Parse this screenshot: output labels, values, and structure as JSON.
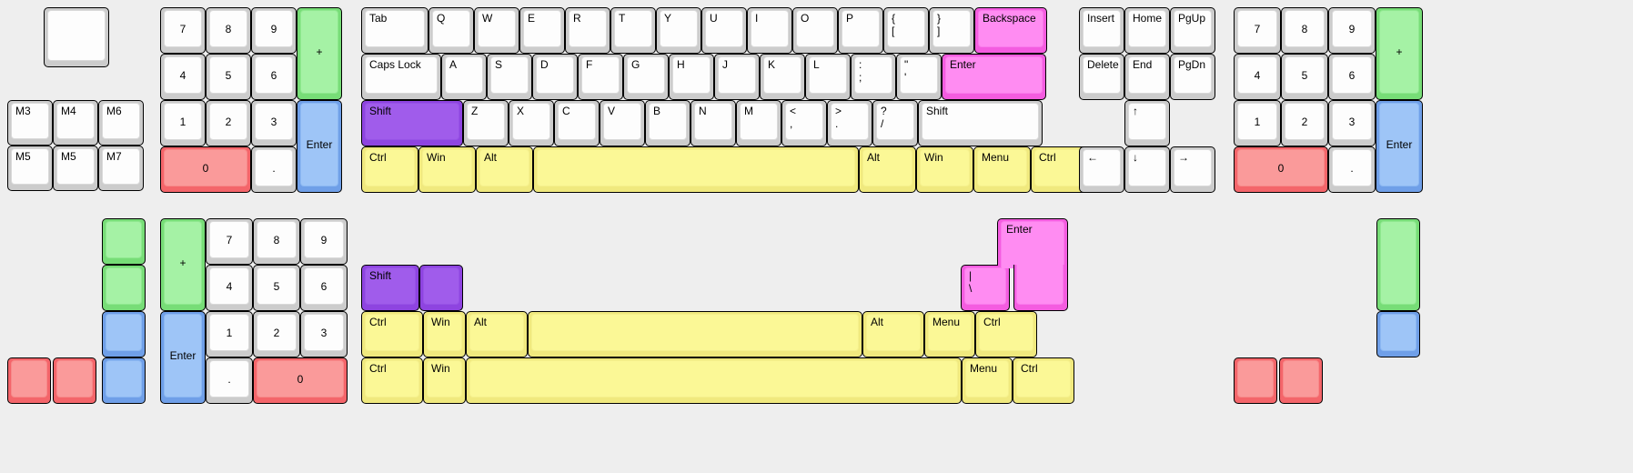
{
  "app": {
    "title": "Keyboard Layout Editor Canvas",
    "background_color": "#eeeeee"
  },
  "palette": {
    "white": "#cccccc",
    "white_cap": "#fdfdfd",
    "green": "#77dd77",
    "green_cap": "#a5f2a5",
    "blue": "#6f9fe8",
    "blue_cap": "#9ec5f7",
    "red": "#f4656a",
    "red_cap": "#fa9a9a",
    "yellow": "#f0e97e",
    "yellow_cap": "#fbf896",
    "purple": "#8e44e0",
    "purple_cap": "#a05ceb",
    "magenta": "#f45ce0",
    "magenta_cap": "#ff8cf2"
  },
  "upper_layout": {
    "standalone_key": {
      "label": ""
    },
    "macro_cluster": {
      "rows": [
        [
          {
            "label": "M3"
          },
          {
            "label": "M4"
          },
          {
            "label": "M6"
          }
        ],
        [
          {
            "label": "M5"
          },
          {
            "label": "M5"
          },
          {
            "label": "M7"
          }
        ]
      ]
    },
    "left_numpad": {
      "rows": [
        [
          {
            "label": "7"
          },
          {
            "label": "8"
          },
          {
            "label": "9"
          },
          {
            "label": "+"
          }
        ],
        [
          {
            "label": "4"
          },
          {
            "label": "5"
          },
          {
            "label": "6"
          }
        ],
        [
          {
            "label": "1"
          },
          {
            "label": "2"
          },
          {
            "label": "3"
          },
          {
            "label": "Enter"
          }
        ],
        [
          {
            "label": "0"
          },
          {
            "label": "."
          }
        ]
      ]
    },
    "main_block": {
      "row_tab": [
        {
          "label": "Tab"
        },
        {
          "label": "Q"
        },
        {
          "label": "W"
        },
        {
          "label": "E"
        },
        {
          "label": "R"
        },
        {
          "label": "T"
        },
        {
          "label": "Y"
        },
        {
          "label": "U"
        },
        {
          "label": "I"
        },
        {
          "label": "O"
        },
        {
          "label": "P"
        },
        {
          "label": "{\n["
        },
        {
          "label": "}\n]"
        },
        {
          "label": "Backspace"
        }
      ],
      "row_caps": [
        {
          "label": "Caps Lock"
        },
        {
          "label": "A"
        },
        {
          "label": "S"
        },
        {
          "label": "D"
        },
        {
          "label": "F"
        },
        {
          "label": "G"
        },
        {
          "label": "H"
        },
        {
          "label": "J"
        },
        {
          "label": "K"
        },
        {
          "label": "L"
        },
        {
          "label": ":\n;"
        },
        {
          "label": "\"\n'"
        },
        {
          "label": "Enter"
        }
      ],
      "row_shift": [
        {
          "label": "Shift"
        },
        {
          "label": "Z"
        },
        {
          "label": "X"
        },
        {
          "label": "C"
        },
        {
          "label": "V"
        },
        {
          "label": "B"
        },
        {
          "label": "N"
        },
        {
          "label": "M"
        },
        {
          "label": "<\n,"
        },
        {
          "label": ">\n."
        },
        {
          "label": "?\n/"
        },
        {
          "label": "Shift"
        }
      ],
      "row_bottom": [
        {
          "label": "Ctrl"
        },
        {
          "label": "Win"
        },
        {
          "label": "Alt"
        },
        {
          "label": ""
        },
        {
          "label": "Alt"
        },
        {
          "label": "Win"
        },
        {
          "label": "Menu"
        },
        {
          "label": "Ctrl"
        }
      ]
    },
    "nav_cluster": {
      "row1": [
        {
          "label": "Insert"
        },
        {
          "label": "Home"
        },
        {
          "label": "PgUp"
        }
      ],
      "row2": [
        {
          "label": "Delete"
        },
        {
          "label": "End"
        },
        {
          "label": "PgDn"
        }
      ],
      "arrow_up": {
        "label": "↑"
      },
      "arrow_row": [
        {
          "label": "←"
        },
        {
          "label": "↓"
        },
        {
          "label": "→"
        }
      ]
    },
    "right_numpad": {
      "rows": [
        [
          {
            "label": "7"
          },
          {
            "label": "8"
          },
          {
            "label": "9"
          },
          {
            "label": "+"
          }
        ],
        [
          {
            "label": "4"
          },
          {
            "label": "5"
          },
          {
            "label": "6"
          }
        ],
        [
          {
            "label": "1"
          },
          {
            "label": "2"
          },
          {
            "label": "3"
          },
          {
            "label": "Enter"
          }
        ],
        [
          {
            "label": "0"
          },
          {
            "label": "."
          }
        ]
      ]
    }
  },
  "lower_layout": {
    "left_color_column": [
      {
        "label": "",
        "color": "green"
      },
      {
        "label": "",
        "color": "green"
      },
      {
        "label": "",
        "color": "blue"
      },
      {
        "label": "",
        "color": "blue"
      }
    ],
    "left_red_pair": [
      {
        "label": "",
        "color": "red"
      },
      {
        "label": "",
        "color": "red"
      }
    ],
    "numpad": {
      "plus": {
        "label": "+"
      },
      "enter": {
        "label": "Enter"
      },
      "rows": [
        [
          {
            "label": "7"
          },
          {
            "label": "8"
          },
          {
            "label": "9"
          }
        ],
        [
          {
            "label": "4"
          },
          {
            "label": "5"
          },
          {
            "label": "6"
          }
        ],
        [
          {
            "label": "1"
          },
          {
            "label": "2"
          },
          {
            "label": "3"
          }
        ],
        [
          {
            "label": "."
          },
          {
            "label": "0"
          }
        ]
      ]
    },
    "shift_group": [
      {
        "label": "Shift"
      },
      {
        "label": ""
      }
    ],
    "iso_enter": {
      "label": "Enter"
    },
    "backslash_key": {
      "label": "|\n\\"
    },
    "row_mod_upper": [
      {
        "label": "Ctrl"
      },
      {
        "label": "Win"
      },
      {
        "label": "Alt"
      },
      {
        "label": ""
      },
      {
        "label": "Alt"
      },
      {
        "label": "Menu"
      },
      {
        "label": "Ctrl"
      }
    ],
    "row_mod_lower": [
      {
        "label": "Ctrl"
      },
      {
        "label": "Win"
      },
      {
        "label": ""
      },
      {
        "label": "Menu"
      },
      {
        "label": "Ctrl"
      }
    ],
    "right_color_column": [
      {
        "label": "",
        "color": "green"
      },
      {
        "label": "",
        "color": "blue"
      }
    ],
    "right_red_pair": [
      {
        "label": "",
        "color": "red"
      },
      {
        "label": "",
        "color": "red"
      }
    ]
  }
}
